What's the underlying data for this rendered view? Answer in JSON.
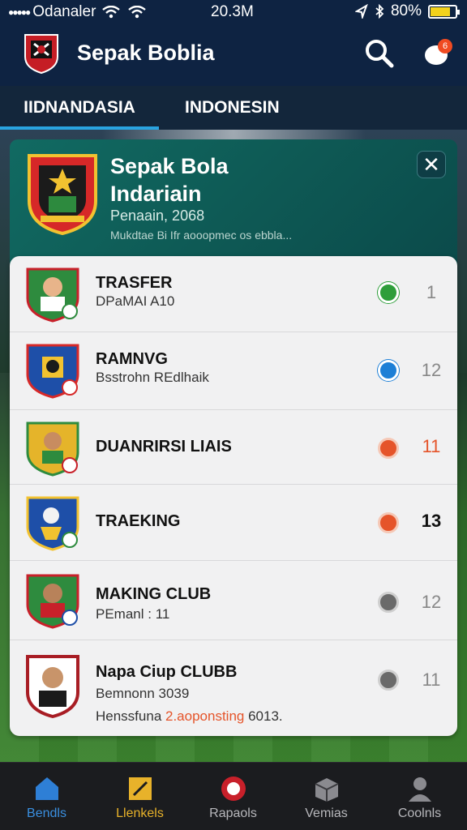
{
  "status_bar": {
    "signal": "●●●●●",
    "carrier": "Odanaler",
    "time": "20.3M",
    "battery": "80%"
  },
  "app": {
    "title": "Sepak Boblia"
  },
  "tabs": [
    {
      "label": "IIDNANDASIA",
      "active": true
    },
    {
      "label": "INDONESIN",
      "active": false
    }
  ],
  "feature": {
    "title_line1": "Sepak Bola",
    "title_line2": "Indariain",
    "subtitle": "Penaain, 2068",
    "description": "Mukdtae Bi Ifr aooopmec os ebbla...",
    "close_label": "✕"
  },
  "list": [
    {
      "name": "TRASFER",
      "sub": "DPaMAI A10",
      "count": "1",
      "status_color": "#2e9e3a",
      "count_color": "#888888"
    },
    {
      "name": "RAMNVG",
      "sub": "Bsstrohn REdlhaik",
      "count": "12",
      "status_color": "#1d7fd6",
      "count_color": "#888888"
    },
    {
      "name": "DUANRIRSI LIAIS",
      "sub": "",
      "count": "11",
      "status_color": "#e5542a",
      "count_color": "#e5542a"
    },
    {
      "name": "TRAEKING",
      "sub": "",
      "count": "13",
      "status_color": "#e5542a",
      "count_color": "#111111"
    },
    {
      "name": "MAKING CLUB",
      "sub": "PEmanl : 11",
      "count": "12",
      "status_color": "#6a6a6a",
      "count_color": "#888888"
    },
    {
      "name": "Napa Ciup CLUBB",
      "sub": "Bemnonn 3039",
      "extra_pre": "Henssfuna ",
      "extra_hl": "2.aoponsting",
      "extra_post": " 6013.",
      "count": "11",
      "status_color": "#6a6a6a",
      "count_color": "#888888"
    }
  ],
  "bottom_nav": [
    {
      "label": "Bendls",
      "icon": "home-icon"
    },
    {
      "label": "Llenkels",
      "icon": "pencil-icon"
    },
    {
      "label": "Rapaols",
      "icon": "ball-icon"
    },
    {
      "label": "Vemias",
      "icon": "box-icon"
    },
    {
      "label": "Coolnls",
      "icon": "user-icon"
    }
  ],
  "colors": {
    "header_bg": "#0e2342",
    "accent": "#29a3e0",
    "feature_bg": "#116a62",
    "nav_active": "#3a8fe0",
    "nav_gold": "#e8b22a"
  }
}
